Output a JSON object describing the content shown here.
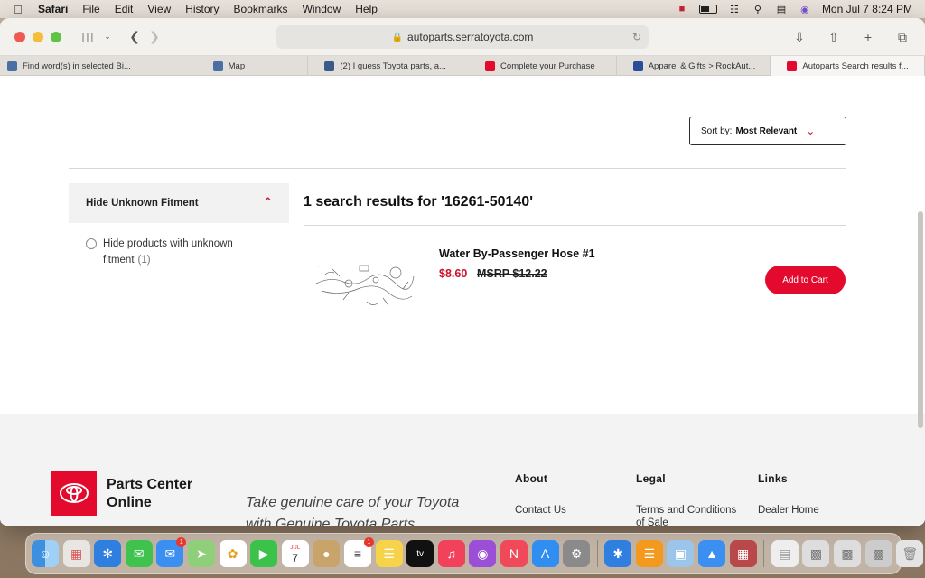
{
  "menubar": {
    "app": "Safari",
    "items": [
      "File",
      "Edit",
      "View",
      "History",
      "Bookmarks",
      "Window",
      "Help"
    ],
    "datetime": "Mon Jul 7  8:24 PM"
  },
  "browser": {
    "url": "autoparts.serratoyota.com",
    "tabs": [
      {
        "label": "Find word(s) in selected Bi...",
        "fav_color": "#4a6fa5"
      },
      {
        "label": "Map",
        "fav_color": "#4a6fa5"
      },
      {
        "label": "(2) I guess Toyota parts, a...",
        "fav_color": "#3b5a8a"
      },
      {
        "label": "Complete your Purchase",
        "fav_color": "#e40a2d"
      },
      {
        "label": "Apparel & Gifts > RockAut...",
        "fav_color": "#2a4d9a"
      },
      {
        "label": "Autoparts Search results f...",
        "fav_color": "#e40a2d"
      }
    ]
  },
  "page": {
    "sort": {
      "label": "Sort by:",
      "value": "Most Relevant"
    },
    "filter": {
      "heading": "Hide Unknown Fitment",
      "option_label": "Hide products with unknown fitment",
      "option_count": "(1)"
    },
    "results_title": "1 search results for '16261-50140'",
    "product": {
      "name": "Water By-Passenger Hose #1",
      "price": "$8.60",
      "msrp": "MSRP $12.22",
      "cta": "Add to Cart"
    },
    "footer": {
      "brand": "Parts Center Online",
      "tagline": "Take genuine care of your Toyota with Genuine Toyota Parts",
      "columns": [
        {
          "heading": "About",
          "link": "Contact Us"
        },
        {
          "heading": "Legal",
          "link": "Terms and Conditions of Sale"
        },
        {
          "heading": "Links",
          "link": "Dealer Home"
        }
      ]
    }
  },
  "dock": {
    "calendar_month": "JUL",
    "calendar_day": "7",
    "mail_badge": "1",
    "reminders_badge": "1",
    "appletv_label": "tv"
  },
  "colors": {
    "accent": "#e40a2d"
  }
}
